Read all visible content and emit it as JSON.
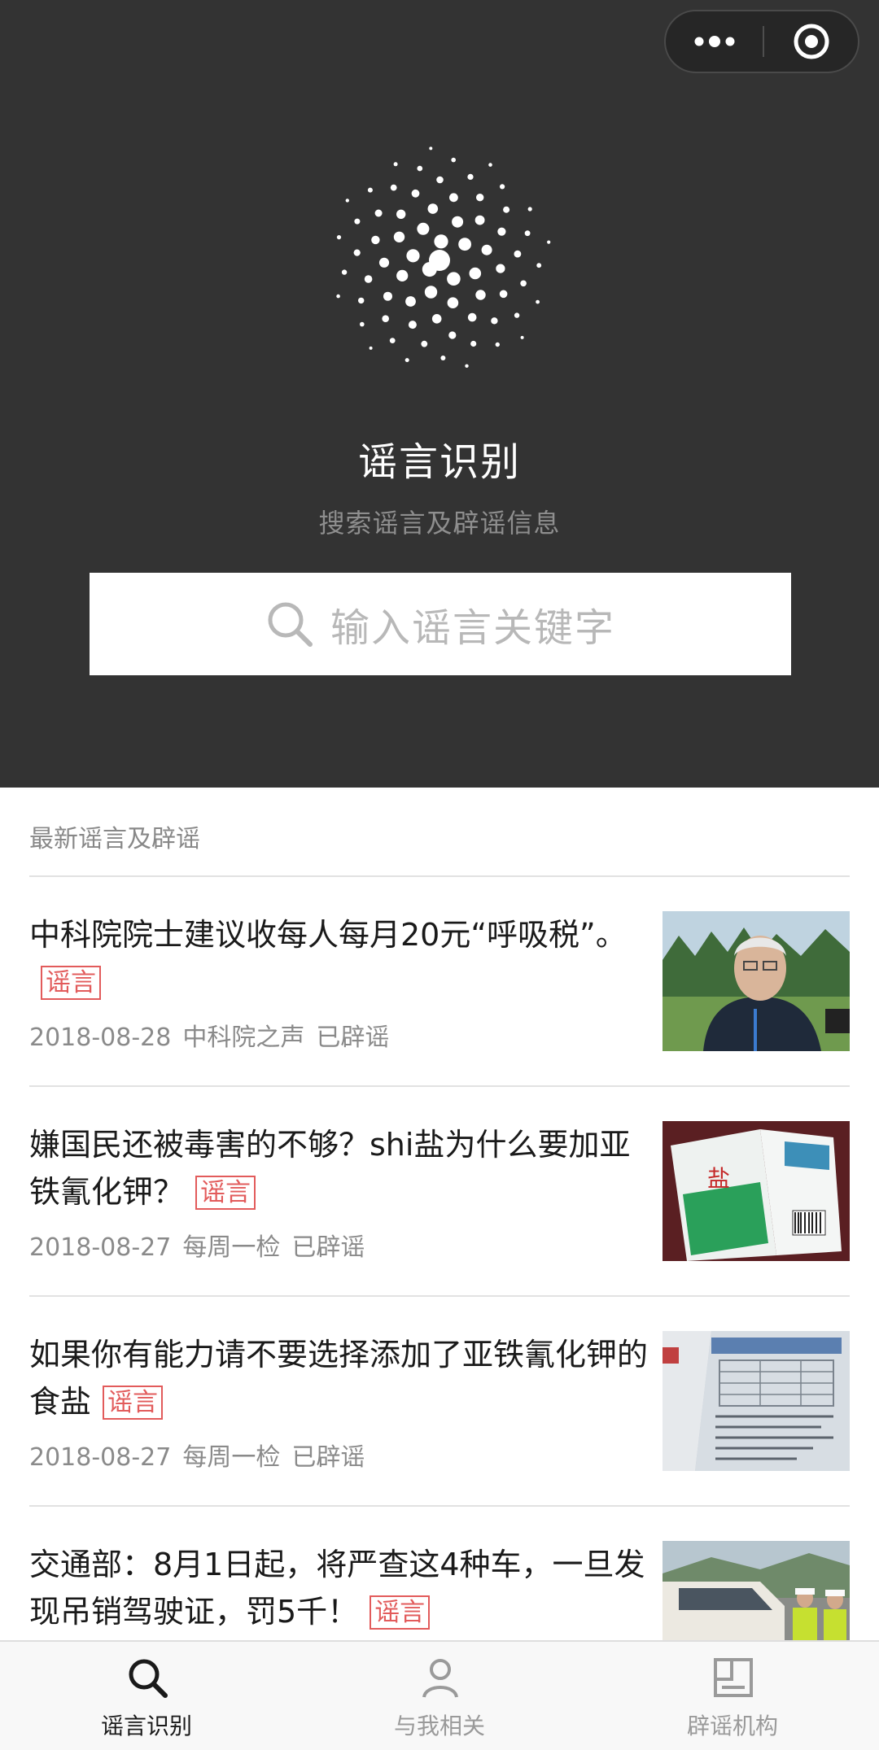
{
  "app": {
    "title": "谣言识别",
    "subtitle": "搜索谣言及辟谣信息"
  },
  "search": {
    "placeholder": "输入谣言关键字"
  },
  "section": {
    "title": "最新谣言及辟谣"
  },
  "news": [
    {
      "title": "中科院院士建议收每人每月20元“呼吸税”。",
      "tag": "谣言",
      "date": "2018-08-28",
      "source": "中科院之声",
      "status": "已辟谣"
    },
    {
      "title": "嫌国民还被毒害的不够？shi盐为什么要加亚铁氰化钾？",
      "tag": "谣言",
      "date": "2018-08-27",
      "source": "每周一检",
      "status": "已辟谣"
    },
    {
      "title": "如果你有能力请不要选择添加了亚铁氰化钾的食盐",
      "tag": "谣言",
      "date": "2018-08-27",
      "source": "每周一检",
      "status": "已辟谣"
    },
    {
      "title": "交通部：8月1日起，将严查这4种车，一旦发现吊销驾驶证，罚5千！",
      "tag": "谣言",
      "date": "",
      "source": "",
      "status": ""
    }
  ],
  "tabs": [
    {
      "label": "谣言识别",
      "icon": "search-icon",
      "active": true
    },
    {
      "label": "与我相关",
      "icon": "person-icon",
      "active": false
    },
    {
      "label": "辟谣机构",
      "icon": "building-icon",
      "active": false
    }
  ],
  "colors": {
    "header_bg": "#333333",
    "tag": "#e25b5b",
    "tab_active": "#1a1a1a",
    "tab_inactive": "#9a9a9a"
  }
}
